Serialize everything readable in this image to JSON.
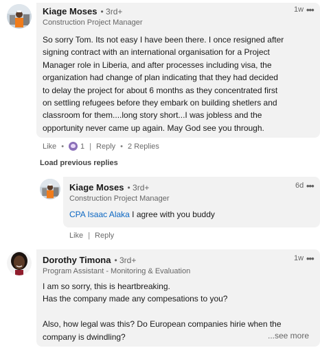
{
  "comments": [
    {
      "author": "Kiage Moses",
      "degree": "• 3rd+",
      "headline": "Construction Project Manager",
      "time": "1w",
      "body_lines": [
        "So sorry Tom. Its not easy I have been there. I once resigned after",
        "signing contract with an international organisation for a Project",
        "Manager role in Liberia, and after processes including visa, the",
        "organization had change of plan indicating that they had decided",
        "to delay the project for about 6 months as they concentrated first",
        "on settling refugees before they embark on building shetlers and",
        "classroom for them....long story short...I was jobless and the",
        "opportunity never came up again. May God see you through."
      ],
      "actions": {
        "like": "Like",
        "reaction_count": "1",
        "reply": "Reply",
        "replies": "2 Replies"
      }
    },
    {
      "author": "Kiage Moses",
      "degree": "• 3rd+",
      "headline": "Construction Project Manager",
      "time": "6d",
      "mention": "CPA Isaac Alaka",
      "body_rest": " I agree with you buddy",
      "actions": {
        "like": "Like",
        "reply": "Reply"
      }
    },
    {
      "author": "Dorothy Timona",
      "degree": "• 3rd+",
      "headline": "Program Assistant - Monitoring & Evaluation",
      "time": "1w",
      "body_lines": [
        "I am so sorry, this is heartbreaking.",
        "Has the company made any compesations to you?",
        "",
        "Also, how legal was this? Do European companies hirie when the",
        "company is dwindling?"
      ],
      "see_more": "...see more"
    }
  ],
  "load_previous": "Load previous replies",
  "more_icon": "•••",
  "colors": {
    "bubble": "#f2f2f2",
    "link": "#0a66c2",
    "muted": "rgba(0,0,0,0.6)"
  }
}
